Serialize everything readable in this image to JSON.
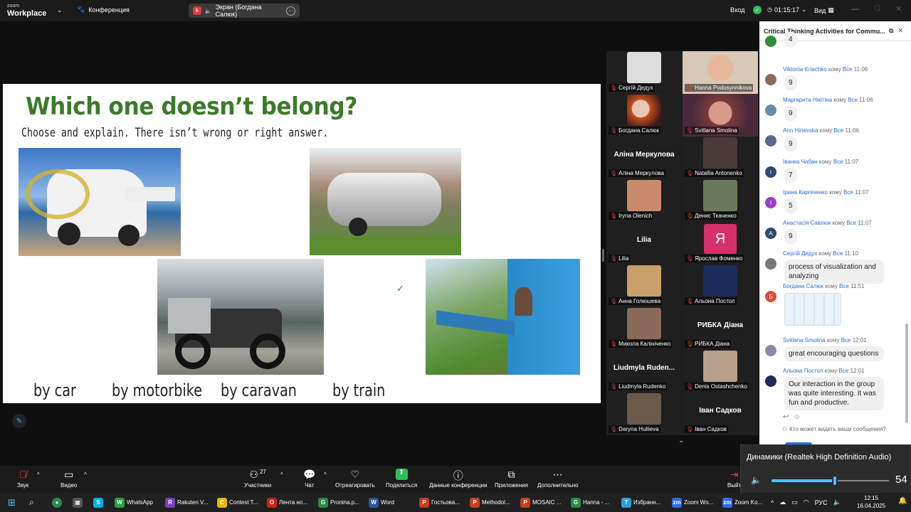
{
  "topbar": {
    "logo_line1": "zoom",
    "logo_line2": "Workplace",
    "meeting_label": "Конференция",
    "share_badge": "Б",
    "share_label": "Экран (Богдана Салюк)",
    "signin": "Вход",
    "timer": "01:15:17",
    "view": "Вид"
  },
  "slide": {
    "title": "Which one doesn’t belong?",
    "subtitle": "Choose and explain. There isn’t wrong or right answer.",
    "captions": [
      "by car",
      "by motorbike",
      "by caravan",
      "by train"
    ]
  },
  "gallery": {
    "tiles": [
      {
        "name": "Сергій Дедух",
        "big": ""
      },
      {
        "name": "Hanna Podosynnikova",
        "big": ""
      },
      {
        "name": "Богдана Салюк",
        "big": ""
      },
      {
        "name": "Svitlana Smolina",
        "big": ""
      },
      {
        "name": "Аліна Меркулова",
        "big": "Аліна Меркулова"
      },
      {
        "name": "Natallia Antonenko",
        "big": ""
      },
      {
        "name": "Iryna Olenich",
        "big": ""
      },
      {
        "name": "Денис Ткаченко",
        "big": ""
      },
      {
        "name": "Lilia",
        "big": "Lilia"
      },
      {
        "name": "Ярослав Фоменко",
        "big": "Я"
      },
      {
        "name": "Анна Голюшева",
        "big": ""
      },
      {
        "name": "Альона Постол",
        "big": ""
      },
      {
        "name": "Микола Калініченко",
        "big": ""
      },
      {
        "name": "РИБКА Діана",
        "big": "РИБКА Діана"
      },
      {
        "name": "Liudmyla Rudenko",
        "big": "Liudmyla  Ruden..."
      },
      {
        "name": "Denis Ostashchenko",
        "big": ""
      },
      {
        "name": "Daryna Huliieva",
        "big": ""
      },
      {
        "name": "Іван Садков",
        "big": "Іван Садков"
      }
    ]
  },
  "chat": {
    "title": "Critical Thinking Activities for Commu...",
    "to_word": "кому",
    "everyone": "Все",
    "messages": [
      {
        "sender": "",
        "time": "",
        "text": "4",
        "avatar": "",
        "color": "#2e8b3a"
      },
      {
        "sender": "Viktoriia Kriachko",
        "time": "11:06",
        "text": "9",
        "avatar": "",
        "color": "#8a6a5a"
      },
      {
        "sender": "Маргарита Нікітіна",
        "time": "11:06",
        "text": "9",
        "avatar": "",
        "color": "#6a8aaa"
      },
      {
        "sender": "Ann Hinevska",
        "time": "11:06",
        "text": "9",
        "avatar": "",
        "color": "#5a6a8a"
      },
      {
        "sender": "Іванка Чабан",
        "time": "11:07",
        "text": "7",
        "avatar": "І",
        "color": "#2e4a6e"
      },
      {
        "sender": "Ірина Карпіченко",
        "time": "11:07",
        "text": "5",
        "avatar": "І",
        "color": "#9b3fc4"
      },
      {
        "sender": "Анастасія Савлюк",
        "time": "11:07",
        "text": "9",
        "avatar": "А",
        "color": "#2e4a6e"
      },
      {
        "sender": "Сергій Дедух",
        "time": "11:10",
        "text": "process of visualization and analyzing",
        "avatar": "",
        "color": "#777"
      },
      {
        "sender": "Богдана Салюк",
        "time": "11:51",
        "text": "",
        "avatar": "Б",
        "color": "#e04a3a"
      },
      {
        "sender": "Svitlana Smolina",
        "time": "12:01",
        "text": "great encouraging questions",
        "avatar": "",
        "color": "#8a8aaa"
      },
      {
        "sender": "Альона Постол",
        "time": "12:01",
        "text": "Our interaction in the group was quite interesting. It was fun and productive.",
        "avatar": "",
        "color": "#1e2a5a"
      }
    ],
    "who_can_see": "Кто может видеть ваши сообщения?"
  },
  "toolbar": {
    "audio": "Звук",
    "video": "Видео",
    "participants": "Участники",
    "participants_count": "27",
    "chat": "Чат",
    "react": "Отреагировать",
    "share": "Поделиться",
    "info": "Данные конференции",
    "apps": "Приложения",
    "more": "Дополнительно",
    "leave": "Выйт"
  },
  "volume": {
    "device": "Динамики (Realtek High Definition Audio)",
    "level": 54
  },
  "taskbar": {
    "apps": [
      {
        "label": "WhatsApp",
        "color": "#25a244",
        "glyph": "W"
      },
      {
        "label": "Rakuten V...",
        "color": "#7a3fc4",
        "glyph": "R"
      },
      {
        "label": "Contest T...",
        "color": "#e6b800",
        "glyph": "C"
      },
      {
        "label": "Лента но...",
        "color": "#d0201a",
        "glyph": "O"
      },
      {
        "label": "Pronina.p...",
        "color": "#2a8a4a",
        "glyph": "G"
      },
      {
        "label": "Word",
        "color": "#2b579a",
        "glyph": "W"
      },
      {
        "label": "Гостьова...",
        "color": "#c43e1c",
        "glyph": "P"
      },
      {
        "label": "Methodol...",
        "color": "#c43e1c",
        "glyph": "P"
      },
      {
        "label": "MOSAIC ...",
        "color": "#c43e1c",
        "glyph": "P"
      },
      {
        "label": "Hanna - ...",
        "color": "#2a8a4a",
        "glyph": "G"
      },
      {
        "label": "Избранн...",
        "color": "#2a9fd8",
        "glyph": "T"
      },
      {
        "label": "Zoom Wo...",
        "color": "#2d6cf0",
        "glyph": "zm"
      },
      {
        "label": "Zoom Ko...",
        "color": "#2d6cf0",
        "glyph": "zm"
      }
    ],
    "lang": "РУС",
    "time": "12:15",
    "date": "16.04.2025"
  }
}
